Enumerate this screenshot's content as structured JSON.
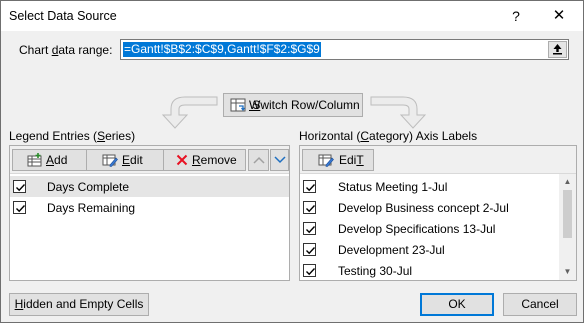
{
  "window": {
    "title": "Select Data Source",
    "help_glyph": "?",
    "close_glyph": "✕"
  },
  "range": {
    "label_pre": "Chart ",
    "label_u": "d",
    "label_post": "ata range:",
    "value": "=Gantt!$B$2:$C$9,Gantt!$F$2:$G$9"
  },
  "switch_button": {
    "pre": "",
    "u": "W",
    "post": "Switch Row/Column"
  },
  "legend": {
    "group_pre": "Legend Entries (",
    "group_u": "S",
    "group_post": "eries)",
    "add": {
      "u": "A",
      "post": "dd"
    },
    "edit": {
      "u": "E",
      "post": "dit"
    },
    "remove": {
      "u": "R",
      "post": "emove"
    },
    "items": [
      {
        "label": "Days Complete",
        "checked": true,
        "selected": true
      },
      {
        "label": "Days Remaining",
        "checked": true,
        "selected": false
      }
    ]
  },
  "axis": {
    "group_pre": "Horizontal (",
    "group_u": "C",
    "group_post": "ategory) Axis Labels",
    "edit": {
      "u": "T",
      "pre": "Edi",
      "post": ""
    },
    "items": [
      {
        "label": "Status Meeting 1-Jul",
        "checked": true
      },
      {
        "label": "Develop Business concept 2-Jul",
        "checked": true
      },
      {
        "label": "Develop Specifications 13-Jul",
        "checked": true
      },
      {
        "label": "Development 23-Jul",
        "checked": true
      },
      {
        "label": "Testing 30-Jul",
        "checked": true
      }
    ]
  },
  "footer": {
    "hidden_pre": "",
    "hidden_u": "H",
    "hidden_post": "idden and Empty Cells",
    "ok": "OK",
    "cancel": "Cancel"
  },
  "icons": [
    "help-icon",
    "close-icon",
    "collapse-dialog-icon",
    "switch-rows-icon",
    "add-series-icon",
    "edit-series-icon",
    "remove-x-icon",
    "move-up-icon",
    "move-down-icon",
    "edit-axis-icon",
    "check-icon",
    "scroll-up-icon",
    "scroll-down-icon"
  ],
  "colors": {
    "selection": "#0078d7",
    "remove_x": "#e81123",
    "default_button_border": "#0078d7"
  }
}
